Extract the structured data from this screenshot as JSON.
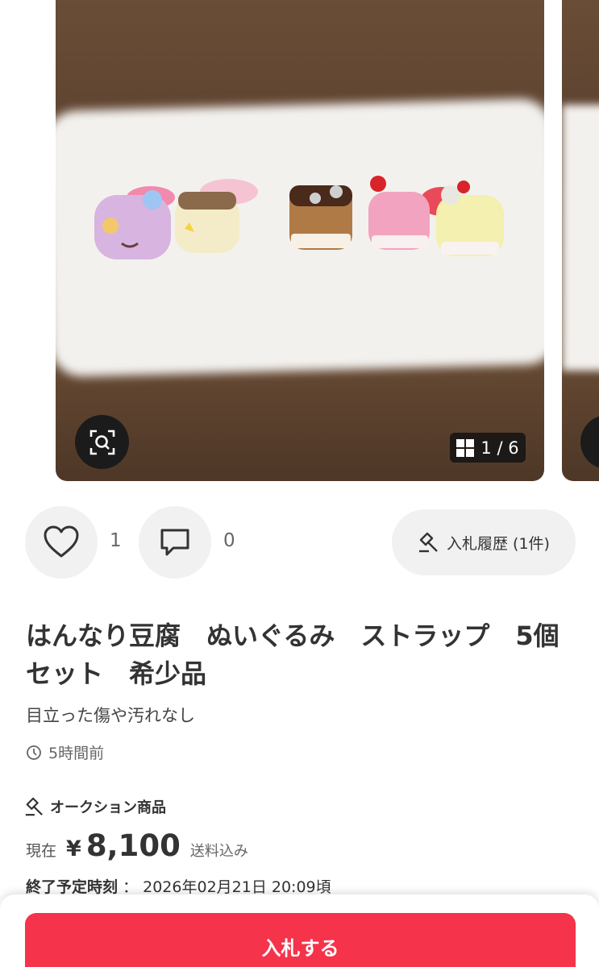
{
  "carousel": {
    "counter_current": "1",
    "counter_sep": "/",
    "counter_total": "6",
    "icons": {
      "zoom": "zoom-search-icon",
      "grid": "grid-icon"
    }
  },
  "actions": {
    "like_count": "1",
    "comment_count": "0",
    "bid_history_label": "入札履歴 (1件)",
    "icons": {
      "like": "heart-icon",
      "comment": "comment-icon",
      "history": "gavel-icon"
    }
  },
  "item": {
    "title": "はんなり豆腐　ぬいぐるみ　ストラップ　5個セット　希少品",
    "description": "目立った傷や汚れなし",
    "posted": "5時間前",
    "auction_label": "オークション商品",
    "price_label": "現在",
    "currency": "¥",
    "price": "8,100",
    "shipping": "送料込み",
    "end_label": "終了予定時刻",
    "end_sep": "：",
    "end_time": "2026年02月21日 20:09頃"
  },
  "bottom": {
    "bid_button": "入札する"
  },
  "colors": {
    "accent": "#f5334a",
    "button_bg": "#f1f1f1"
  }
}
